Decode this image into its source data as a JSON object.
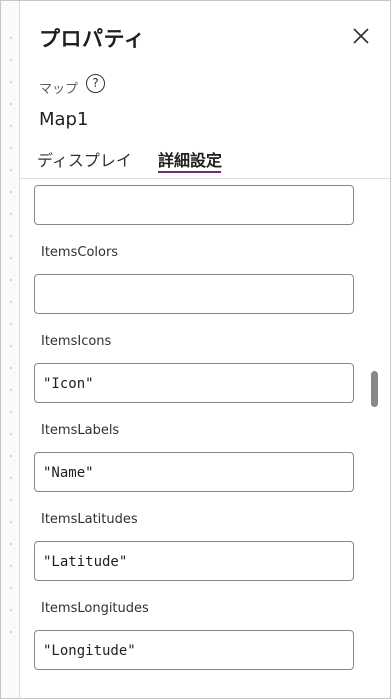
{
  "panel": {
    "title": "プロパティ",
    "control_type": "マップ",
    "help_glyph": "?",
    "control_name": "Map1"
  },
  "tabs": [
    {
      "label": "ディスプレイ",
      "active": false
    },
    {
      "label": "詳細設定",
      "active": true
    }
  ],
  "properties": [
    {
      "label": "",
      "value": ""
    },
    {
      "label": "ItemsColors",
      "value": ""
    },
    {
      "label": "ItemsIcons",
      "value": "\"Icon\""
    },
    {
      "label": "ItemsLabels",
      "value": "\"Name\""
    },
    {
      "label": "ItemsLatitudes",
      "value": "\"Latitude\""
    },
    {
      "label": "ItemsLongitudes",
      "value": "\"Longitude\""
    }
  ],
  "colors": {
    "accent": "#742774",
    "border": "#8a8886"
  }
}
